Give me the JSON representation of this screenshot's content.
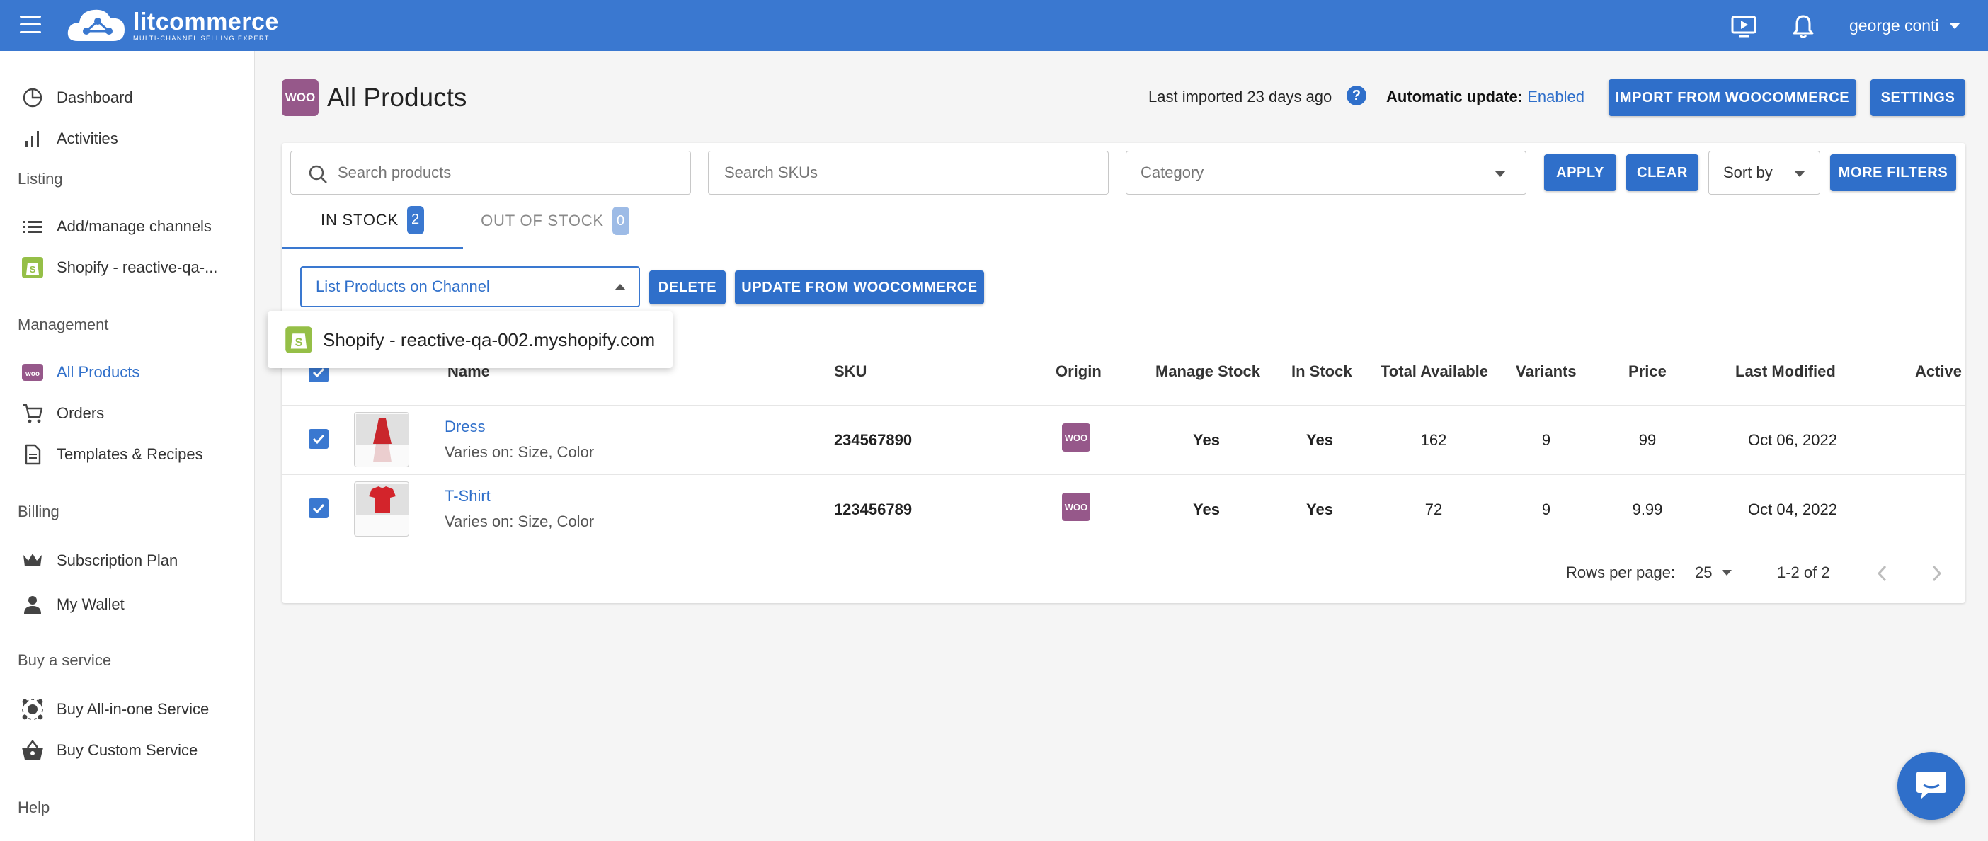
{
  "header": {
    "brand_name": "litcommerce",
    "brand_tagline": "MULTI-CHANNEL SELLING EXPERT",
    "user_name": "george conti",
    "icons": [
      "menu-icon",
      "video-tutorial-icon",
      "bell-icon",
      "chevron-down-icon"
    ]
  },
  "sidebar": {
    "items": [
      {
        "label": "Dashboard",
        "icon": "dashboard-icon"
      },
      {
        "label": "Activities",
        "icon": "bar-chart-icon"
      },
      {
        "label": "Add/manage channels",
        "icon": "list-icon"
      },
      {
        "label": "Shopify - reactive-qa-...",
        "icon": "shopify-icon"
      },
      {
        "label": "All Products",
        "icon": "woocommerce-icon",
        "active": true
      },
      {
        "label": "Orders",
        "icon": "cart-icon"
      },
      {
        "label": "Templates & Recipes",
        "icon": "document-icon"
      },
      {
        "label": "Subscription Plan",
        "icon": "crown-icon"
      },
      {
        "label": "My Wallet",
        "icon": "person-icon"
      },
      {
        "label": "Buy All-in-one Service",
        "icon": "network-icon"
      },
      {
        "label": "Buy Custom Service",
        "icon": "basket-icon"
      }
    ],
    "sections": {
      "listing": "Listing",
      "management": "Management",
      "billing": "Billing",
      "buy_service": "Buy a service",
      "help": "Help"
    }
  },
  "page": {
    "woo_badge": "WOO",
    "title": "All Products",
    "last_imported": "Last imported 23 days ago",
    "help_glyph": "?",
    "auto_update_label": "Automatic update:",
    "auto_update_value": "Enabled",
    "import_button": "IMPORT FROM WOOCOMMERCE",
    "settings_button": "SETTINGS"
  },
  "filters": {
    "search_placeholder": "Search products",
    "sku_placeholder": "Search SKUs",
    "category_placeholder": "Category",
    "apply_button": "APPLY",
    "clear_button": "CLEAR",
    "sort_label": "Sort by",
    "more_filters_button": "MORE FILTERS"
  },
  "tabs": [
    {
      "label": "IN STOCK",
      "count": "2",
      "active": true
    },
    {
      "label": "OUT OF STOCK",
      "count": "0",
      "active": false
    }
  ],
  "bulk": {
    "action_selected": "List Products on Channel",
    "delete_button": "DELETE",
    "update_button": "UPDATE FROM WOOCOMMERCE",
    "dropdown_option": "Shopify - reactive-qa-002.myshopify.com"
  },
  "table": {
    "columns": [
      "Name",
      "SKU",
      "Origin",
      "Manage Stock",
      "In Stock",
      "Total Available",
      "Variants",
      "Price",
      "Last Modified",
      "Active"
    ],
    "rows": [
      {
        "name": "Dress",
        "varies": "Varies on: Size, Color",
        "sku": "234567890",
        "origin_badge": "WOO",
        "manage_stock": "Yes",
        "in_stock": "Yes",
        "total_available": "162",
        "variants": "9",
        "price": "99",
        "last_modified": "Oct 06, 2022"
      },
      {
        "name": "T-Shirt",
        "varies": "Varies on: Size, Color",
        "sku": "123456789",
        "origin_badge": "WOO",
        "manage_stock": "Yes",
        "in_stock": "Yes",
        "total_available": "72",
        "variants": "9",
        "price": "9.99",
        "last_modified": "Oct 04, 2022"
      }
    ]
  },
  "pagination": {
    "rows_per_page_label": "Rows per page:",
    "rows_per_page_value": "25",
    "range": "1-2 of 2"
  },
  "colors": {
    "primary": "#3a78d0",
    "woo_purple": "#96588a",
    "shopify_green": "#95bf47"
  }
}
